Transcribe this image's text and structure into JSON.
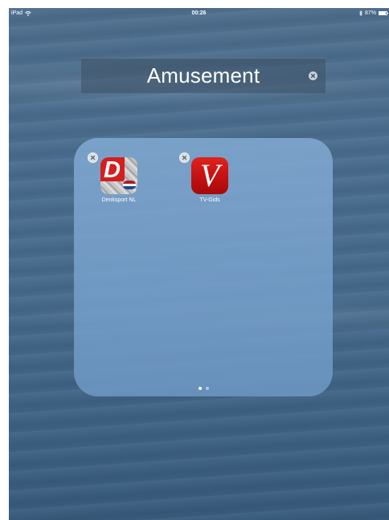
{
  "status_bar": {
    "device": "iPad",
    "time": "00:26",
    "battery": "87%",
    "battery_level": 0.87,
    "icons": [
      "wifi-icon",
      "bluetooth-icon",
      "battery-icon"
    ]
  },
  "folder": {
    "name": "Amusement",
    "clear_icon": "clear-circle-icon",
    "apps": [
      {
        "label": "Denksport NL",
        "icon": "denksport-app-icon",
        "letter": "D",
        "delete_icon": "delete-x-icon"
      },
      {
        "label": "TV-Gids",
        "icon": "tvgids-app-icon",
        "letter": "V",
        "delete_icon": "delete-x-icon"
      }
    ],
    "pages": {
      "count": 2,
      "current": 1
    }
  },
  "colors": {
    "wallpaper": "#476a8c",
    "folder_panel": "#7ea6cf",
    "app_red": "#d41f1f",
    "flag": [
      "#ae1c28",
      "#ffffff",
      "#21468b"
    ]
  }
}
